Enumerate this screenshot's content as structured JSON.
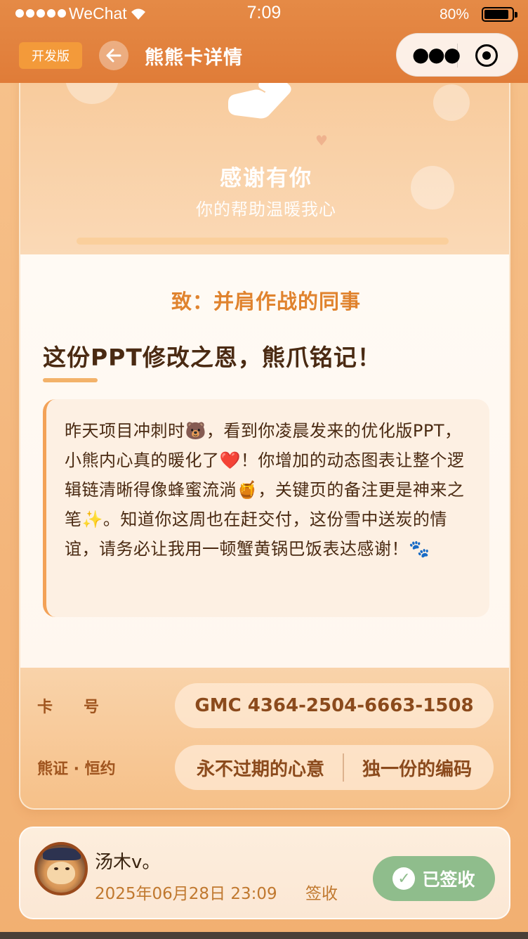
{
  "status_bar": {
    "carrier": "WeChat",
    "time": "7:09",
    "battery": "80%"
  },
  "nav": {
    "dev_badge": "开发版",
    "title": "熊熊卡详情"
  },
  "hero": {
    "title": "感谢有你",
    "subtitle": "你的帮助温暖我心"
  },
  "letter": {
    "to": "致：并肩作战的同事",
    "headline": "这份PPT修改之恩，熊爪铭记！",
    "body": "昨天项目冲刺时🐻，看到你凌晨发来的优化版PPT，小熊内心真的暖化了❤️！你增加的动态图表让整个逻辑链清晰得像蜂蜜流淌🍯，关键页的备注更是神来之笔✨。知道你这周也在赶交付，这份雪中送炭的情谊，请务必让我用一顿蟹黄锅巴饭表达感谢！🐾"
  },
  "info": {
    "card_no_label": "卡　　号",
    "card_no": "GMC 4364-2504-6663-1508",
    "cert_label": "熊证 · 恒约",
    "cert_left": "永不过期的心意",
    "cert_right": "独一份的编码"
  },
  "signer": {
    "name": "汤木v。",
    "date": "2025年06月28日 23:09",
    "action": "签收",
    "status_button": "已签收"
  },
  "colors": {
    "nav_bg": "#e07c38",
    "accent": "#e0832e",
    "signed_green": "#8fbd8c"
  }
}
